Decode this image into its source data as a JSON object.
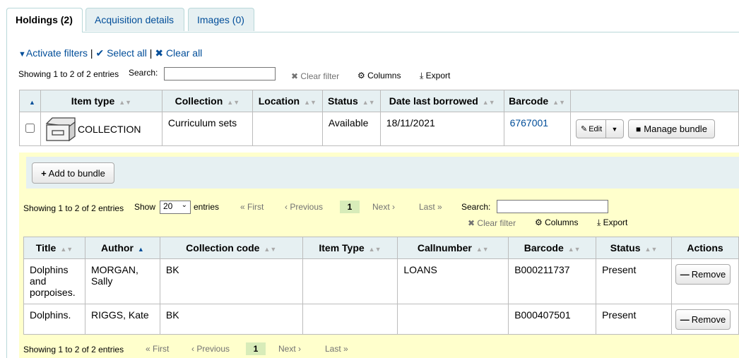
{
  "tabs": [
    {
      "label": "Holdings (2)",
      "active": true
    },
    {
      "label": "Acquisition details",
      "active": false
    },
    {
      "label": "Images (0)",
      "active": false
    }
  ],
  "filters": {
    "activate": "Activate filters",
    "select_all": "Select all",
    "clear_all": "Clear all",
    "sep": "|"
  },
  "holdings": {
    "info": "Showing 1 to 2 of 2 entries",
    "search_label": "Search:",
    "search_value": "",
    "clear_filter": "Clear filter",
    "columns": "Columns",
    "export": "Export",
    "headers": [
      "Item type",
      "Collection",
      "Location",
      "Status",
      "Date last borrowed",
      "Barcode"
    ],
    "row": {
      "item_type": "COLLECTION",
      "collection": "Curriculum sets",
      "location": "",
      "status": "Available",
      "date_last_borrowed": "18/11/2021",
      "barcode": "6767001",
      "edit": "Edit",
      "manage_bundle": "Manage bundle"
    },
    "add_to_bundle": "Add to bundle"
  },
  "bundle": {
    "info": "Showing 1 to 2 of 2 entries",
    "show": "Show",
    "page_size": "20",
    "entries": "entries",
    "first": "« First",
    "previous": "‹ Previous",
    "page": "1",
    "next": "Next ›",
    "last": "Last »",
    "search_label": "Search:",
    "search_value": "",
    "clear_filter": "Clear filter",
    "columns": "Columns",
    "export": "Export",
    "headers": [
      "Title",
      "Author",
      "Collection code",
      "Item Type",
      "Callnumber",
      "Barcode",
      "Status",
      "Actions"
    ],
    "rows": [
      {
        "title": "Dolphins and porpoises.",
        "author": "MORGAN, Sally",
        "collection_code": "BK",
        "item_type": "",
        "callnumber": "LOANS",
        "barcode": "B000211737",
        "status": "Present",
        "action": "Remove"
      },
      {
        "title": "Dolphins.",
        "author": "RIGGS, Kate",
        "collection_code": "BK",
        "item_type": "",
        "callnumber": "",
        "barcode": "B000407501",
        "status": "Present",
        "action": "Remove"
      }
    ],
    "footer_info": "Showing 1 to 2 of 2 entries",
    "footer_first": "« First",
    "footer_previous": "‹ Previous",
    "footer_page": "1",
    "footer_next": "Next ›",
    "footer_last": "Last »"
  },
  "colors": {
    "link": "#004d99",
    "header_bg": "#e6f0f2",
    "bundle_bg": "#ffffcc",
    "current_page": "#d8ecb9"
  }
}
